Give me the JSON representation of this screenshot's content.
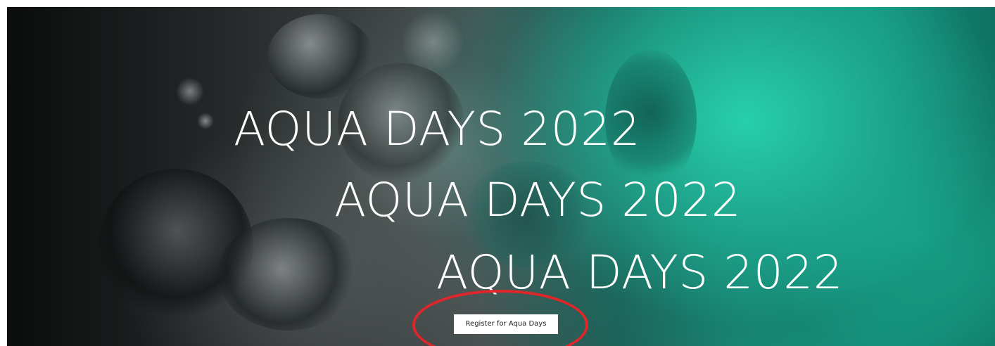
{
  "hero": {
    "headlines": [
      "AQUA DAYS 2022",
      "AQUA DAYS 2022",
      "AQUA DAYS 2022"
    ],
    "register_label": "Register for Aqua Days"
  },
  "colors": {
    "accent_teal": "#1a9a85",
    "dark_background": "#0b0d0d",
    "headline_text": "#ffffff",
    "button_background": "#ffffff",
    "annotation_ring": "#e0262a"
  }
}
